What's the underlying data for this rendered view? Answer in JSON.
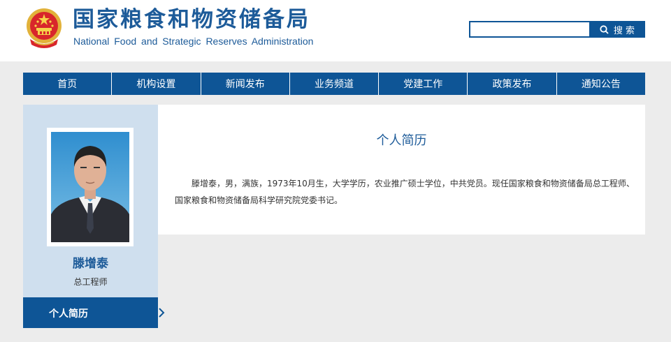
{
  "header": {
    "title_cn": "国家粮食和物资储备局",
    "title_en": "National Food and Strategic Reserves Administration",
    "emblem_icon": "national-emblem-icon"
  },
  "search": {
    "placeholder": "",
    "value": "",
    "button_label": "搜 索",
    "icon": "search-icon"
  },
  "nav": {
    "items": [
      {
        "label": "首页"
      },
      {
        "label": "机构设置"
      },
      {
        "label": "新闻发布"
      },
      {
        "label": "业务频道"
      },
      {
        "label": "党建工作"
      },
      {
        "label": "政策发布"
      },
      {
        "label": "通知公告"
      }
    ]
  },
  "profile": {
    "name": "滕增泰",
    "position": "总工程师",
    "tab_label": "个人简历"
  },
  "content": {
    "title": "个人简历",
    "bio": "滕增泰，男，满族，1973年10月生，大学学历，农业推广硕士学位，中共党员。现任国家粮食和物资储备局总工程师、国家粮食和物资储备局科学研究院党委书记。"
  },
  "colors": {
    "brand_blue": "#0e5596",
    "title_blue": "#1d5b99",
    "sidebar_bg": "#cfdfee",
    "page_bg": "#ececec"
  }
}
